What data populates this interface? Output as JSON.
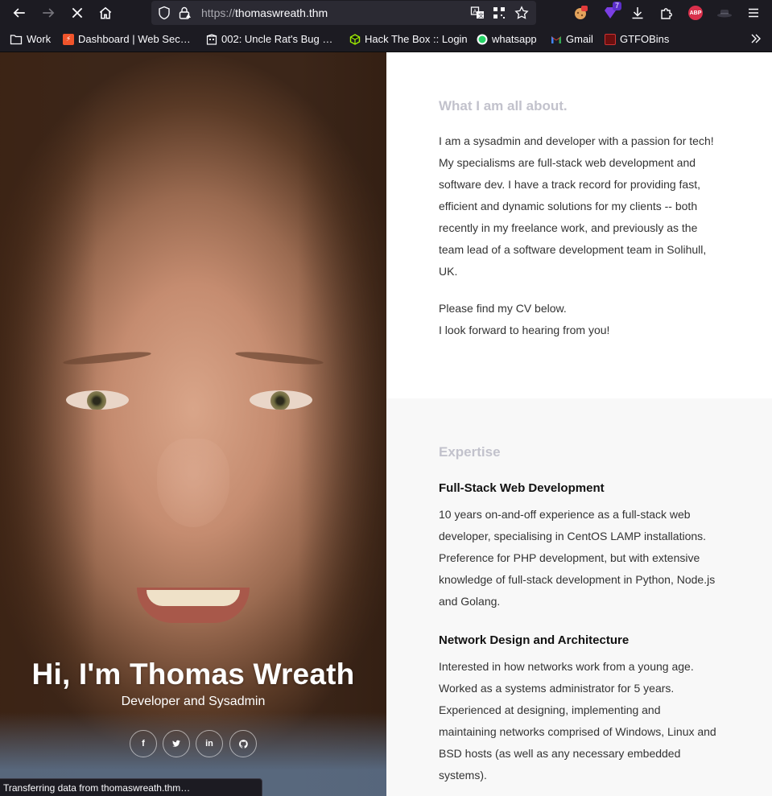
{
  "browser": {
    "url_protocol": "https://",
    "url_host": "thomaswreath.thm",
    "bookmarks": [
      {
        "label": "Work",
        "icon": "folder-icon"
      },
      {
        "label": "Dashboard | Web Sec…",
        "icon": "portswigger-icon"
      },
      {
        "label": "002: Uncle Rat's Bug …",
        "icon": "building-icon"
      },
      {
        "label": "Hack The Box :: Login",
        "icon": "cube-icon"
      },
      {
        "label": "whatsapp",
        "icon": "whatsapp-icon"
      },
      {
        "label": "Gmail",
        "icon": "gmail-icon"
      },
      {
        "label": "GTFOBins",
        "icon": "gtfobins-icon"
      }
    ],
    "extension_badge": "7",
    "abp_label": "ABP",
    "status_text": "Transferring data from thomaswreath.thm…"
  },
  "hero": {
    "title": "Hi, I'm Thomas Wreath",
    "subtitle": "Developer and Sysadmin",
    "social": [
      {
        "label": "f",
        "icon": "facebook-icon"
      },
      {
        "label": "t",
        "icon": "twitter-icon"
      },
      {
        "label": "in",
        "icon": "linkedin-icon"
      },
      {
        "label": "gh",
        "icon": "github-icon"
      }
    ]
  },
  "about": {
    "title": "What I am all about.",
    "paragraph1": "I am a sysadmin and developer with a passion for tech! My specialisms are full-stack web development and software dev. I have a track record for providing fast, efficient and dynamic solutions for my clients -- both recently in my freelance work, and previously as the team lead of a software development team in Solihull, UK.",
    "line1": "Please find my CV below.",
    "line2": "I look forward to hearing from you!"
  },
  "expertise": {
    "title": "Expertise",
    "items": [
      {
        "heading": "Full-Stack Web Development",
        "text": "10 years on-and-off experience as a full-stack web developer, specialising in CentOS LAMP installations. Preference for PHP development, but with extensive knowledge of full-stack development in Python, Node.js and Golang."
      },
      {
        "heading": "Network Design and Architecture",
        "text": "Interested in how networks work from a young age. Worked as a systems administrator for 5 years. Experienced at designing, implementing and maintaining networks comprised of Windows, Linux and BSD hosts (as well as any necessary embedded systems)."
      }
    ]
  }
}
